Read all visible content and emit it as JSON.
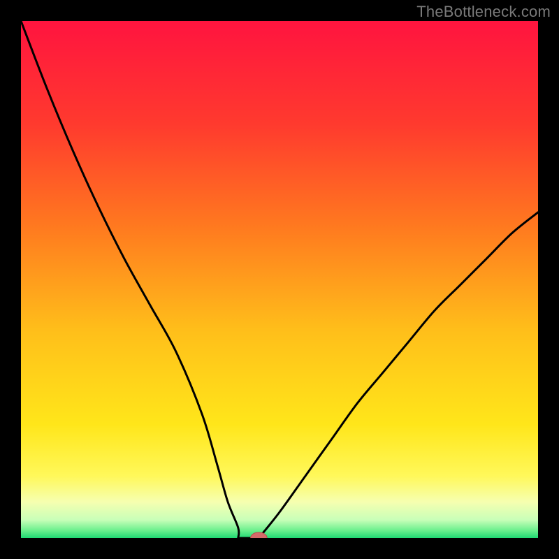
{
  "attribution": "TheBottleneck.com",
  "colors": {
    "gradient_stops": [
      {
        "offset": 0.0,
        "color": "#ff143f"
      },
      {
        "offset": 0.2,
        "color": "#ff3a2e"
      },
      {
        "offset": 0.4,
        "color": "#ff7a1f"
      },
      {
        "offset": 0.6,
        "color": "#ffbf1a"
      },
      {
        "offset": 0.78,
        "color": "#ffe61a"
      },
      {
        "offset": 0.88,
        "color": "#fff85a"
      },
      {
        "offset": 0.93,
        "color": "#f6ffb0"
      },
      {
        "offset": 0.965,
        "color": "#c8ffb8"
      },
      {
        "offset": 0.985,
        "color": "#6cf08e"
      },
      {
        "offset": 1.0,
        "color": "#1fd973"
      }
    ],
    "curve": "#000000",
    "marker_fill": "#d46a6a",
    "marker_stroke": "#b94c4c"
  },
  "chart_data": {
    "type": "line",
    "title": "",
    "xlabel": "",
    "ylabel": "",
    "xlim": [
      0,
      100
    ],
    "ylim": [
      0,
      100
    ],
    "series": [
      {
        "name": "bottleneck-curve",
        "x": [
          0,
          5,
          10,
          15,
          20,
          25,
          30,
          35,
          38,
          40,
          42,
          44,
          46,
          50,
          55,
          60,
          65,
          70,
          75,
          80,
          85,
          90,
          95,
          100
        ],
        "y": [
          100,
          87,
          75,
          64,
          54,
          45,
          36,
          24,
          14,
          7,
          2,
          0,
          0,
          5,
          12,
          19,
          26,
          32,
          38,
          44,
          49,
          54,
          59,
          63
        ]
      }
    ],
    "flat_bottom": {
      "x_start": 42,
      "x_end": 46,
      "y": 0
    },
    "marker": {
      "x": 46,
      "y": 0,
      "rx": 1.6,
      "ry": 1.1
    }
  }
}
